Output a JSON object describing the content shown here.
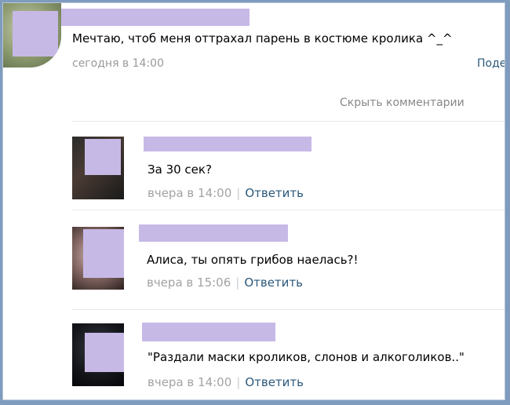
{
  "post": {
    "text": "Мечтаю, чтоб меня оттрахал парень в костюме кролика ^_^",
    "date": "сегодня в 14:00",
    "share_label": "Поде"
  },
  "hide_comments_label": "Скрыть комментарии",
  "comments": [
    {
      "text": "За 30 сек?",
      "date": "вчера в 14:00",
      "sep": "|",
      "reply_label": "Ответить"
    },
    {
      "text": "Алиса, ты опять грибов наелась?!",
      "date": "вчера в 15:06",
      "sep": "|",
      "reply_label": "Ответить"
    },
    {
      "text": "\"Раздали маски кроликов, слонов и алкоголиков..\"",
      "date": "вчера в 14:00",
      "sep": "|",
      "reply_label": "Ответить"
    }
  ],
  "colors": {
    "link": "#2b587a",
    "muted": "#999999",
    "censor": "#c7b9e6",
    "outer_border": "#7f9bbd"
  }
}
